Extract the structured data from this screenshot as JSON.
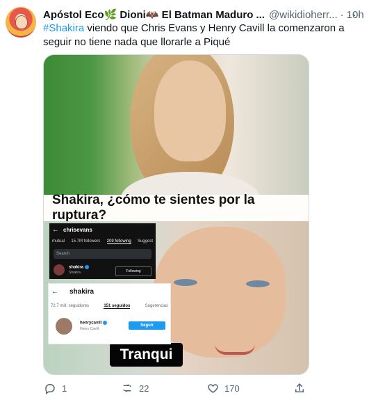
{
  "tweet": {
    "author_name": "Apóstol Eco🌿 Dioni🦇 El Batman Maduro ...",
    "handle": "@wikidioherr...",
    "separator": "·",
    "time": "10h",
    "more_label": "···",
    "hashtag": "#Shakira",
    "text_after_hashtag": " viendo que Chris Evans y Henry Cavill la comenzaron a seguir no tiene nada que llorarle a Piqué"
  },
  "meme": {
    "top_caption": "Shakira,  ¿cómo te sientes por  la ruptura?",
    "bottom_caption": "Tranqui",
    "chris_ig": {
      "back": "←",
      "username": "chrisevans",
      "tabs": [
        "mutual",
        "15.7M followers",
        "209 following",
        "Suggest"
      ],
      "search_placeholder": "Search",
      "row_name": "shakira",
      "row_sub": "Shakira",
      "button": "Following"
    },
    "shakira_ig": {
      "back": "←",
      "username": "shakira",
      "tabs": [
        "72.7 mill. seguidores",
        "151 seguidos",
        "Sugerencias"
      ],
      "row_name": "henrycavill",
      "row_sub": "Henry Cavill",
      "button": "Seguir"
    }
  },
  "actions": {
    "reply_icon": "reply-icon",
    "reply_count": "1",
    "retweet_icon": "retweet-icon",
    "retweet_count": "22",
    "like_icon": "heart-icon",
    "like_count": "170",
    "share_icon": "share-icon"
  },
  "colors": {
    "link": "#1d9bf0",
    "secondary_text": "#536471"
  }
}
